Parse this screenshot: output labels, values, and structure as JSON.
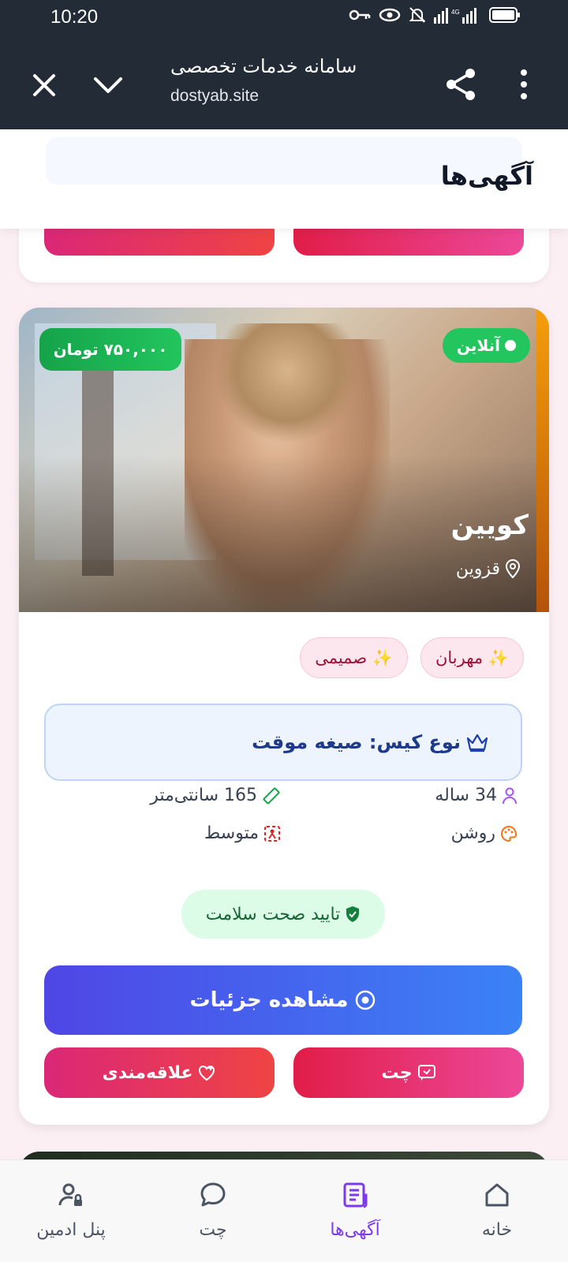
{
  "status_bar": {
    "time": "10:20"
  },
  "browser": {
    "page_name": "سامانه خدمات تخصصی",
    "domain": "dostyab.site"
  },
  "header": {
    "title": "آگهی‌ها"
  },
  "listing": {
    "status": "آنلاین",
    "price": "۷۵۰,۰۰۰ تومان",
    "name": "کویین",
    "city": "قزوین",
    "tags": [
      "✨ مهربان",
      "✨ صمیمی"
    ],
    "case_type": "نوع کیس: صیغه موقت",
    "age": "34 ساله",
    "height": "165 سانتی‌متر",
    "skin": "روشن",
    "body": "متوسط",
    "health": "تایید صحت سلامت",
    "details_label": "مشاهده جزئیات",
    "chat_label": "چت",
    "favorite_label": "علاقه‌مندی"
  },
  "bottom_nav": {
    "items": [
      {
        "label": "خانه",
        "icon": "home-icon"
      },
      {
        "label": "آگهی‌ها",
        "icon": "listings-icon",
        "active": true
      },
      {
        "label": "چت",
        "icon": "chat-icon"
      },
      {
        "label": "پنل ادمین",
        "icon": "admin-icon"
      }
    ]
  },
  "colors": {
    "topbar": "#222b36",
    "accent": "#7c3aed",
    "online": "#22c55e",
    "details_button": "#4f46e5",
    "chat_button": "#e11d48"
  }
}
